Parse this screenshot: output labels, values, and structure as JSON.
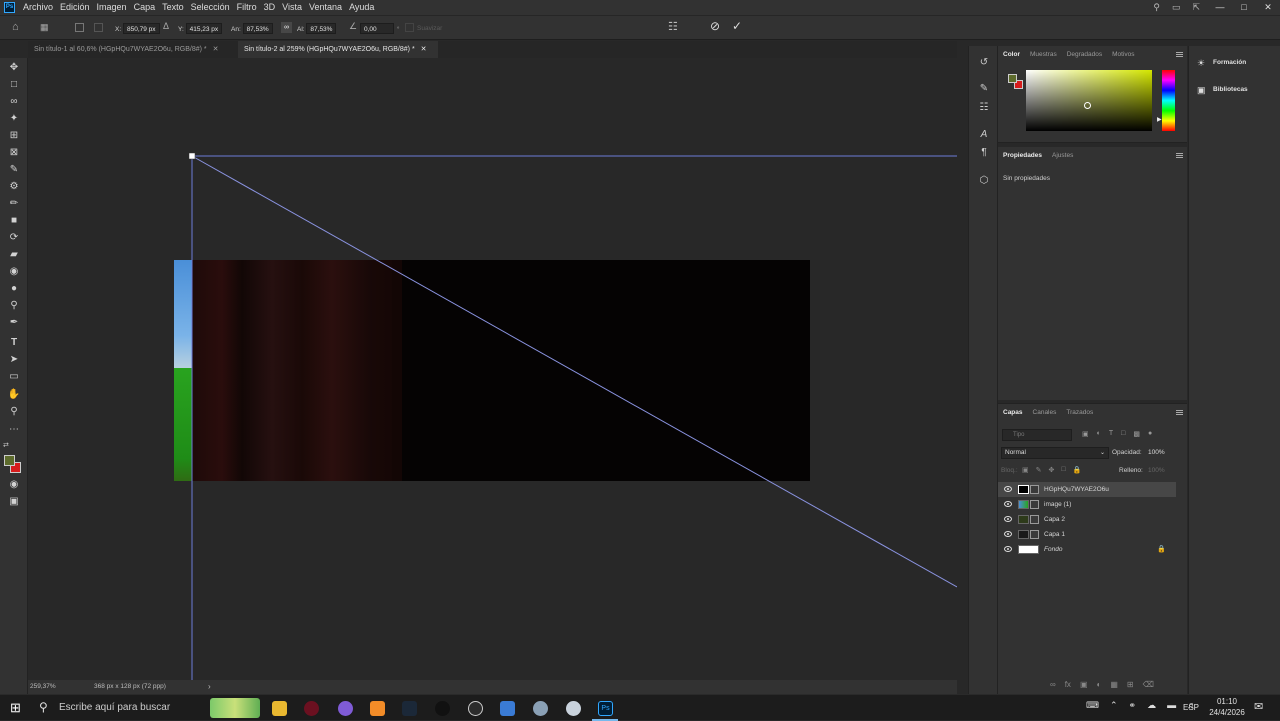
{
  "app": {
    "logo": "Ps"
  },
  "menu": [
    "Archivo",
    "Edición",
    "Imagen",
    "Capa",
    "Texto",
    "Selección",
    "Filtro",
    "3D",
    "Vista",
    "Ventana",
    "Ayuda"
  ],
  "options": {
    "x_label": "X:",
    "x_value": "850,79 px",
    "y_label": "Y:",
    "y_value": "415,23 px",
    "w_label": "An:",
    "w_value": "87,53%",
    "h_label": "Al:",
    "h_value": "87,53%",
    "angle_value": "0,00",
    "angle_unit": "°",
    "interp": "Suavizar"
  },
  "tabs": [
    {
      "label": "Sin título-1 al 60,6% (HGpHQu7WYAE2O6u, RGB/8#) *"
    },
    {
      "label": "Sin título-2 al 259% (HGpHQu7WYAE2O6u, RGB/8#) *"
    }
  ],
  "status": {
    "zoom": "259,37%",
    "doc_info": "368 px x 128 px (72 ppp)"
  },
  "color_panel": {
    "tabs": [
      "Color",
      "Muestras",
      "Degradados",
      "Motivos"
    ],
    "fg_color": "#5d6b2c",
    "bg_color": "#d61c1c",
    "hue_color": "#d4e600"
  },
  "properties_panel": {
    "tabs": [
      "Propiedades",
      "Ajustes"
    ],
    "message": "Sin propiedades"
  },
  "far_right": {
    "items": [
      "Formación",
      "Bibliotecas"
    ]
  },
  "layers_panel": {
    "tabs": [
      "Capas",
      "Canales",
      "Trazados"
    ],
    "filter_placeholder": "Tipo",
    "blend_mode": "Normal",
    "opacity_label": "Opacidad:",
    "opacity_value": "100%",
    "lock_label": "Bloq.:",
    "fill_label": "Relleno:",
    "fill_value": "100%",
    "layers": [
      {
        "name": "HGpHQu7WYAE2O6u",
        "selected": true
      },
      {
        "name": "image (1)",
        "selected": false
      },
      {
        "name": "Capa 2",
        "selected": false
      },
      {
        "name": "Capa 1",
        "selected": false
      },
      {
        "name": "Fondo",
        "selected": false,
        "locked": true
      }
    ]
  },
  "taskbar": {
    "search_placeholder": "Escribe aquí para buscar",
    "lang": "ESP",
    "time": "01:10",
    "date": "24/4/2026"
  }
}
